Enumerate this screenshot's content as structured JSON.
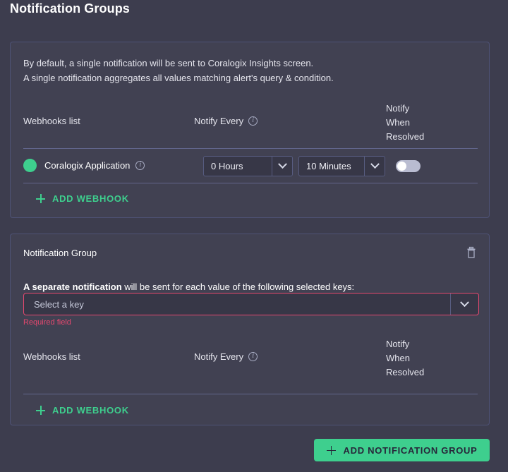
{
  "page": {
    "title": "Notification Groups"
  },
  "default_group": {
    "intro_line_1": "By default, a single notification will be sent to Coralogix Insights screen.",
    "intro_line_2": "A single notification aggregates all values matching alert's query & condition.",
    "columns": {
      "webhooks_list": "Webhooks list",
      "notify_every": "Notify Every",
      "notify_when_resolved_1": "Notify",
      "notify_when_resolved_2": "When",
      "notify_when_resolved_3": "Resolved"
    },
    "webhook_row": {
      "name": "Coralogix Application",
      "status_color": "#3ecf8e",
      "hours_value": "0 Hours",
      "minutes_value": "10 Minutes",
      "notify_when_resolved_on": false
    },
    "add_webhook_label": "ADD WEBHOOK"
  },
  "notification_group": {
    "title": "Notification Group",
    "keys_label_bold": "A separate notification",
    "keys_label_rest": " will be sent for each value of the following selected keys:",
    "key_select_placeholder": "Select a key",
    "key_select_value": "",
    "error_text": "Required field",
    "columns": {
      "webhooks_list": "Webhooks list",
      "notify_every": "Notify Every",
      "notify_when_resolved_1": "Notify",
      "notify_when_resolved_2": "When",
      "notify_when_resolved_3": "Resolved"
    },
    "add_webhook_label": "ADD WEBHOOK"
  },
  "footer": {
    "add_notification_group_label": "ADD NOTIFICATION GROUP"
  },
  "colors": {
    "page_background": "#3d3d4e",
    "card_background": "#414152",
    "card_border": "#4e5275",
    "accent_green": "#3ecf8e",
    "error_pink": "#e5486f",
    "divider": "#62668c",
    "text_primary": "#ffffff",
    "text_secondary": "#c6c9da"
  }
}
